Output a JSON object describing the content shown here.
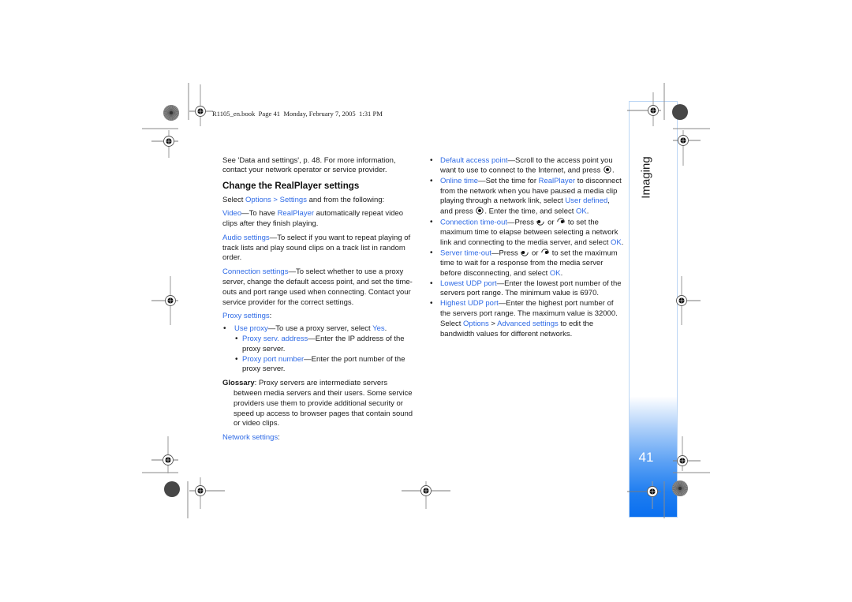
{
  "header": {
    "slug": "R1105_en.book  Page 41  Monday, February 7, 2005  1:31 PM"
  },
  "sidebar": {
    "section_title": "Imaging",
    "page_number": "41"
  },
  "colors": {
    "link": "#2f6be6",
    "body_text": "#1b1b1b",
    "sidebar_blue": "#0a6fef",
    "sidebar_border": "#bcd6f5"
  },
  "left_column": [
    {
      "type": "p",
      "segments": [
        {
          "k": "plain",
          "t": "See 'Data and settings', p. 48. For more information, contact your network operator or service provider."
        }
      ]
    },
    {
      "type": "h",
      "segments": [
        {
          "k": "plain",
          "t": "Change the RealPlayer settings"
        }
      ]
    },
    {
      "type": "p",
      "segments": [
        {
          "k": "plain",
          "t": "Select "
        },
        {
          "k": "link",
          "t": "Options > Settings"
        },
        {
          "k": "plain",
          "t": " and from the following:"
        }
      ]
    },
    {
      "type": "p",
      "segments": [
        {
          "k": "link",
          "t": "Video"
        },
        {
          "k": "plain",
          "t": "—To have "
        },
        {
          "k": "link",
          "t": "RealPlayer"
        },
        {
          "k": "plain",
          "t": " automatically repeat video clips after they finish playing."
        }
      ]
    },
    {
      "type": "p",
      "segments": [
        {
          "k": "link",
          "t": "Audio settings"
        },
        {
          "k": "plain",
          "t": "—To select if you want to repeat playing of track lists and play sound clips on a track list in random order."
        }
      ]
    },
    {
      "type": "p",
      "segments": [
        {
          "k": "link",
          "t": "Connection settings"
        },
        {
          "k": "plain",
          "t": "—To select whether to use a proxy server, change the default access point, and set the time-outs and port range used when connecting. Contact your service provider for the correct settings."
        }
      ]
    },
    {
      "type": "p-tight",
      "segments": [
        {
          "k": "link",
          "t": "Proxy settings"
        },
        {
          "k": "plain",
          "t": ":"
        }
      ]
    },
    {
      "type": "bullet",
      "segments": [
        {
          "k": "link",
          "t": "Use proxy"
        },
        {
          "k": "plain",
          "t": "—To use a proxy server, select "
        },
        {
          "k": "link",
          "t": "Yes"
        },
        {
          "k": "plain",
          "t": "."
        }
      ]
    },
    {
      "type": "subbullet",
      "segments": [
        {
          "k": "link",
          "t": "Proxy serv. address"
        },
        {
          "k": "plain",
          "t": "—Enter the IP address of the proxy server."
        }
      ]
    },
    {
      "type": "subbullet-last",
      "segments": [
        {
          "k": "link",
          "t": "Proxy port number"
        },
        {
          "k": "plain",
          "t": "—Enter the port number of the proxy server."
        }
      ]
    },
    {
      "type": "glossary",
      "segments": [
        {
          "k": "bold",
          "t": "Glossary"
        },
        {
          "k": "plain",
          "t": ": Proxy servers are intermediate servers between media servers and their users. Some service providers use them to provide additional security or speed up access to browser pages that contain sound or video clips."
        }
      ]
    },
    {
      "type": "p",
      "segments": [
        {
          "k": "link",
          "t": "Network settings"
        },
        {
          "k": "plain",
          "t": ":"
        }
      ]
    }
  ],
  "right_column": [
    {
      "type": "bullet",
      "segments": [
        {
          "k": "link",
          "t": "Default access point"
        },
        {
          "k": "plain",
          "t": "—Scroll to the access point you want to use to connect to the Internet, and press "
        },
        {
          "icon": "select-key"
        },
        {
          "k": "plain",
          "t": "."
        }
      ]
    },
    {
      "type": "bullet",
      "segments": [
        {
          "k": "link",
          "t": "Online time"
        },
        {
          "k": "plain",
          "t": "—Set the time for "
        },
        {
          "k": "link",
          "t": "RealPlayer"
        },
        {
          "k": "plain",
          "t": " to disconnect from the network when you have paused a media clip playing through a network link, select "
        },
        {
          "k": "link",
          "t": "User defined"
        },
        {
          "k": "plain",
          "t": ", and press "
        },
        {
          "icon": "select-key"
        },
        {
          "k": "plain",
          "t": ". Enter the time, and select "
        },
        {
          "k": "link",
          "t": "OK"
        },
        {
          "k": "plain",
          "t": "."
        }
      ]
    },
    {
      "type": "bullet",
      "segments": [
        {
          "k": "link",
          "t": "Connection time-out"
        },
        {
          "k": "plain",
          "t": "—Press "
        },
        {
          "icon": "joystick-left"
        },
        {
          "k": "plain",
          "t": " or "
        },
        {
          "icon": "joystick-right"
        },
        {
          "k": "plain",
          "t": " to set the maximum time to elapse between selecting a network link and connecting to the media server, and select "
        },
        {
          "k": "link",
          "t": "OK"
        },
        {
          "k": "plain",
          "t": "."
        }
      ]
    },
    {
      "type": "bullet",
      "segments": [
        {
          "k": "link",
          "t": "Server time-out"
        },
        {
          "k": "plain",
          "t": "—Press "
        },
        {
          "icon": "joystick-left"
        },
        {
          "k": "plain",
          "t": " or "
        },
        {
          "icon": "joystick-right"
        },
        {
          "k": "plain",
          "t": " to set the maximum time to wait for a response from the media server before disconnecting, and select "
        },
        {
          "k": "link",
          "t": "OK"
        },
        {
          "k": "plain",
          "t": "."
        }
      ]
    },
    {
      "type": "bullet",
      "segments": [
        {
          "k": "link",
          "t": "Lowest UDP port"
        },
        {
          "k": "plain",
          "t": "—Enter the lowest port number of the servers port range. The minimum value is 6970."
        }
      ]
    },
    {
      "type": "bullet",
      "segments": [
        {
          "k": "link",
          "t": "Highest UDP port"
        },
        {
          "k": "plain",
          "t": "—Enter the highest port number of the servers port range. The maximum value is 32000. Select "
        },
        {
          "k": "link",
          "t": "Options"
        },
        {
          "k": "plain",
          "t": " > "
        },
        {
          "k": "link",
          "t": "Advanced settings"
        },
        {
          "k": "plain",
          "t": " to edit the bandwidth values for different networks."
        }
      ]
    }
  ]
}
